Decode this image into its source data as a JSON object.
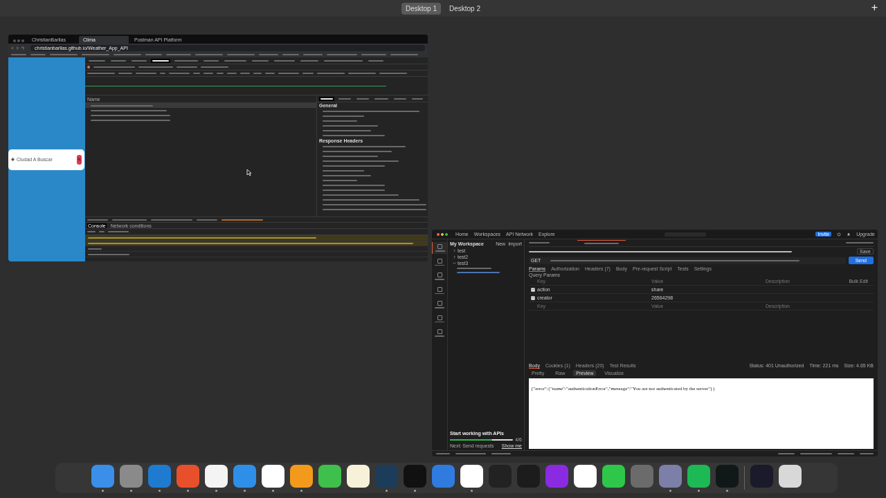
{
  "spaces": [
    {
      "label": "Desktop 1",
      "selected": true
    },
    {
      "label": "Desktop 2",
      "selected": false
    }
  ],
  "add_space": "+",
  "browser": {
    "tabs": [
      {
        "label": "ChristianBarllas",
        "selected": false
      },
      {
        "label": "Clima",
        "selected": true
      },
      {
        "label": "Postman API Platform",
        "selected": false
      }
    ],
    "url": "christianbarllas.github.io/Weather_App_API",
    "page": {
      "placeholder": "Ciudad A Buscar"
    },
    "devtools": {
      "tabs": [
        {
          "selected": false
        },
        {
          "selected": false
        },
        {
          "selected": false
        },
        {
          "selected": true
        },
        {
          "selected": false
        },
        {
          "selected": false
        },
        {
          "selected": false
        },
        {
          "selected": false
        },
        {
          "selected": false
        },
        {
          "selected": false
        },
        {
          "selected": false
        },
        {
          "selected": false
        }
      ],
      "name_column": "Name",
      "requests": [
        {
          "selected": true
        },
        {
          "selected": false
        },
        {
          "selected": false
        },
        {
          "selected": false
        }
      ],
      "detail_tabs": [
        {
          "selected": true
        },
        {
          "selected": false
        },
        {
          "selected": false
        },
        {
          "selected": false
        },
        {
          "selected": false
        },
        {
          "selected": false
        }
      ],
      "general_title": "General",
      "response_title": "Response Headers",
      "drawer_tabs": [
        {
          "label": "Console",
          "selected": true
        },
        {
          "label": "Network conditions",
          "selected": false
        }
      ],
      "messages": [
        {
          "kind": "warning"
        },
        {
          "kind": "warning"
        },
        {
          "kind": "log"
        },
        {
          "kind": "log"
        }
      ]
    }
  },
  "postman": {
    "nav": [
      "Home",
      "Workspaces",
      "API Network",
      "Explore"
    ],
    "invite": "Invite",
    "upgrade": "Upgrade",
    "workspace": "My Workspace",
    "new": "New",
    "import": "Import",
    "rail": [
      {
        "selected": true
      },
      {
        "selected": false
      },
      {
        "selected": false
      },
      {
        "selected": false
      },
      {
        "selected": false
      },
      {
        "selected": false
      },
      {
        "selected": false
      }
    ],
    "collections": [
      {
        "name": "test",
        "expanded": false
      },
      {
        "name": "test2",
        "expanded": false
      },
      {
        "name": "test3",
        "expanded": true
      }
    ],
    "save": "Save",
    "method": "GET",
    "send": "Send",
    "req_tabs": [
      {
        "label": "Params",
        "selected": true
      },
      {
        "label": "Authorization",
        "selected": false
      },
      {
        "label": "Headers (7)",
        "selected": false
      },
      {
        "label": "Body",
        "selected": false
      },
      {
        "label": "Pre-request Script",
        "selected": false
      },
      {
        "label": "Tests",
        "selected": false
      },
      {
        "label": "Settings",
        "selected": false
      }
    ],
    "query_title": "Query Params",
    "columns": [
      "Key",
      "Value",
      "Description"
    ],
    "bulk": "Bulk Edit",
    "params": [
      {
        "key": "action",
        "value": "share",
        "checked": true
      },
      {
        "key": "creator",
        "value": "26564298",
        "checked": true
      }
    ],
    "key_ph": "Key",
    "value_ph": "Value",
    "desc_ph": "Description",
    "res_tabs": [
      {
        "label": "Body",
        "selected": true
      },
      {
        "label": "Cookies (1)",
        "selected": false
      },
      {
        "label": "Headers (20)",
        "selected": false
      },
      {
        "label": "Test Results",
        "selected": false
      }
    ],
    "status": "Status: 401 Unauthorized",
    "time": "Time: 221 ms",
    "size": "Size: 4.65 KB",
    "views": [
      {
        "label": "Pretty",
        "selected": false
      },
      {
        "label": "Raw",
        "selected": false
      },
      {
        "label": "Preview",
        "selected": true
      },
      {
        "label": "Visualize",
        "selected": false
      }
    ],
    "body": "{\"error\":{\"name\":\"authenticationError\",\"message\":\"You are not authenticated by the server\"}}",
    "onboarding": {
      "title": "Start working with APIs",
      "level": 0.67,
      "count": "4/6",
      "hint": "Next: Send requests",
      "action": "Show me"
    }
  },
  "dock": [
    {
      "running": true
    },
    {
      "running": true
    },
    {
      "running": true
    },
    {
      "running": true
    },
    {
      "running": true
    },
    {
      "running": true
    },
    {
      "running": true
    },
    {
      "running": true
    },
    {
      "running": false
    },
    {
      "running": false
    },
    {
      "running": true
    },
    {
      "running": true
    },
    {
      "running": false
    },
    {
      "running": true
    },
    {
      "running": false
    },
    {
      "running": false
    },
    {
      "running": false
    },
    {
      "running": false
    },
    {
      "running": false
    },
    {
      "running": false
    },
    {
      "running": true
    },
    {
      "running": true
    },
    {
      "running": true
    },
    {
      "running": false
    },
    {
      "running": false
    }
  ]
}
